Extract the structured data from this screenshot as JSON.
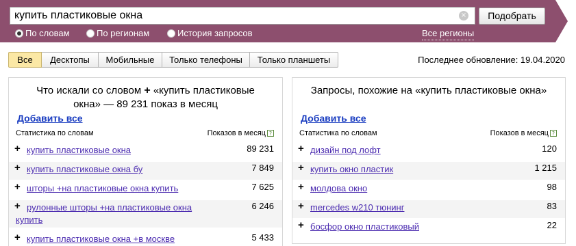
{
  "search": {
    "query": "купить пластиковые окна",
    "clear_glyph": "×",
    "submit_label": "Подобрать"
  },
  "modes": [
    {
      "label": "По словам",
      "selected": true
    },
    {
      "label": "По регионам",
      "selected": false
    },
    {
      "label": "История запросов",
      "selected": false
    }
  ],
  "regions_link": "Все регионы",
  "tabs": [
    "Все",
    "Десктопы",
    "Мобильные",
    "Только телефоны",
    "Только планшеты"
  ],
  "last_update": "Последнее обновление: 19.04.2020",
  "left_panel": {
    "title_part1": "Что искали со словом",
    "title_plus": "+",
    "title_part2": "«купить пластиковые",
    "title_line2": "окна» — 89 231 показ в месяц",
    "add_all": "Добавить все",
    "col_words": "Статистика по словам",
    "col_views": "Показов в месяц",
    "help_glyph": "?",
    "rows": [
      {
        "plus": "+",
        "keyword": "купить пластиковые окна",
        "count": "89 231"
      },
      {
        "plus": "+",
        "keyword": "купить пластиковые окна бу",
        "count": "7 849"
      },
      {
        "plus": "+",
        "keyword": "шторы +на пластиковые окна купить",
        "count": "7 625"
      },
      {
        "plus": "+",
        "keyword": "рулонные шторы +на пластиковые окна купить",
        "count": "6 246"
      },
      {
        "plus": "+",
        "keyword": "купить пластиковые окна +в москве",
        "count": "5 433"
      }
    ]
  },
  "right_panel": {
    "title": "Запросы, похожие на «купить пластиковые окна»",
    "add_all": "Добавить все",
    "col_words": "Статистика по словам",
    "col_views": "Показов в месяц",
    "help_glyph": "?",
    "rows": [
      {
        "plus": "+",
        "keyword": "дизайн под лофт",
        "count": "120"
      },
      {
        "plus": "+",
        "keyword": "купить окно пластик",
        "count": "1 215"
      },
      {
        "plus": "+",
        "keyword": "молдова окно",
        "count": "98"
      },
      {
        "plus": "+",
        "keyword": "mercedes w210 тюнинг",
        "count": "83"
      },
      {
        "plus": "+",
        "keyword": "босфор окно пластиковый",
        "count": "22"
      }
    ]
  },
  "colors": {
    "banner": "#8d4f6e",
    "link": "#4b2bb0",
    "add_all": "#1a3dc1",
    "active_tab": "#fbe8a5"
  }
}
